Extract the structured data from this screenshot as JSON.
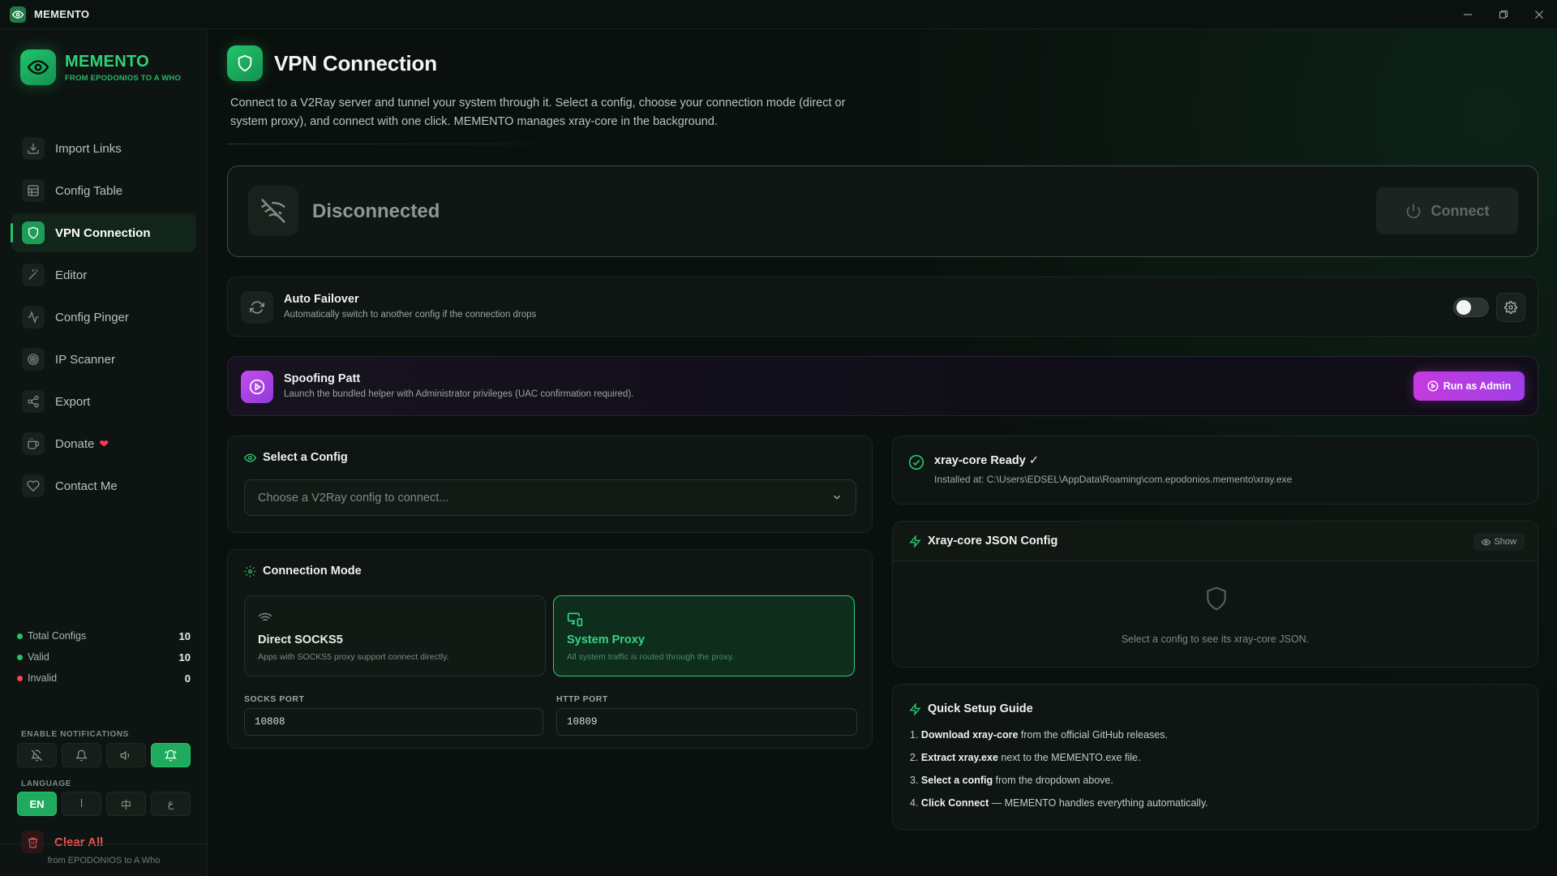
{
  "window": {
    "title": "MEMENTO"
  },
  "brand": {
    "name": "MEMENTO",
    "tagline": "FROM EPODONIOS TO A WHO"
  },
  "nav": [
    {
      "label": "Import Links",
      "icon": "download-icon"
    },
    {
      "label": "Config Table",
      "icon": "table-icon"
    },
    {
      "label": "VPN Connection",
      "icon": "shield-icon",
      "active": true
    },
    {
      "label": "Editor",
      "icon": "magic-wand-icon"
    },
    {
      "label": "Config Pinger",
      "icon": "activity-icon"
    },
    {
      "label": "IP Scanner",
      "icon": "radar-icon"
    },
    {
      "label": "Export",
      "icon": "share-icon"
    },
    {
      "label": "Donate",
      "icon": "coffee-icon",
      "suffix": "❤"
    },
    {
      "label": "Contact Me",
      "icon": "heart-handshake-icon"
    }
  ],
  "stats": {
    "total": {
      "label": "Total Configs",
      "value": "10",
      "color": "#22c46a"
    },
    "valid": {
      "label": "Valid",
      "value": "10",
      "color": "#22c46a"
    },
    "invalid": {
      "label": "Invalid",
      "value": "0",
      "color": "#f04848"
    }
  },
  "notifications": {
    "label": "ENABLE NOTIFICATIONS"
  },
  "language": {
    "label": "LANGUAGE",
    "options": [
      "EN",
      "ا",
      "中",
      "ع"
    ],
    "selected": "EN"
  },
  "clear_all": {
    "label": "Clear All"
  },
  "footer": {
    "text": "from EPODONIOS to A Who"
  },
  "page": {
    "title": "VPN Connection",
    "description": "Connect to a V2Ray server and tunnel your system through it. Select a config, choose your connection mode (direct or system proxy), and connect with one click. MEMENTO manages xray-core in the background."
  },
  "status": {
    "text": "Disconnected",
    "connect_label": "Connect"
  },
  "auto_failover": {
    "title": "Auto Failover",
    "subtitle": "Automatically switch to another config if the connection drops",
    "enabled": false
  },
  "spoofing": {
    "title": "Spoofing Patt",
    "subtitle": "Launch the bundled helper with Administrator privileges (UAC confirmation required).",
    "button": "Run as Admin"
  },
  "select_config": {
    "title": "Select a Config",
    "placeholder": "Choose a V2Ray config to connect..."
  },
  "connection_mode": {
    "title": "Connection Mode",
    "direct": {
      "title": "Direct SOCKS5",
      "subtitle": "Apps with SOCKS5 proxy support connect directly."
    },
    "system": {
      "title": "System Proxy",
      "subtitle": "All system traffic is routed through the proxy.",
      "selected": true
    },
    "socks_label": "SOCKS PORT",
    "socks_port": "10808",
    "http_label": "HTTP PORT",
    "http_port": "10809"
  },
  "xray_status": {
    "title": "xray-core Ready ✓",
    "path": "Installed at: C:\\Users\\EDSEL\\AppData\\Roaming\\com.epodonios.memento\\xray.exe"
  },
  "json_config": {
    "title": "Xray-core JSON Config",
    "show_label": "Show",
    "empty_text": "Select a config to see its xray-core JSON."
  },
  "guide": {
    "title": "Quick Setup Guide",
    "steps": [
      {
        "num": "1.",
        "bold": "Download xray-core",
        "rest": " from the official GitHub releases."
      },
      {
        "num": "2.",
        "bold": "Extract xray.exe",
        "rest": " next to the MEMENTO.exe file."
      },
      {
        "num": "3.",
        "bold": "Select a config",
        "rest": " from the dropdown above."
      },
      {
        "num": "4.",
        "bold": "Click Connect",
        "rest": " — MEMENTO handles everything automatically."
      }
    ]
  },
  "colors": {
    "accent": "#22c46a",
    "danger": "#f05454",
    "purple": "#b23fe4"
  }
}
